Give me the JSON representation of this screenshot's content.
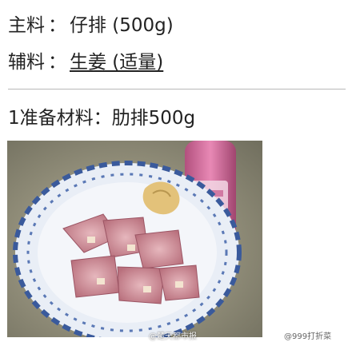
{
  "ingredients": {
    "main": {
      "label": "主料",
      "colon": "：",
      "value": "仔排 (500g)"
    },
    "aux": {
      "label": "辅料",
      "colon": "：",
      "value": "生姜 (适量)"
    }
  },
  "step": {
    "number": "1",
    "text": "准备材料：肋排500g"
  },
  "photo": {
    "description_icon": "photo-of-ribs-and-ginger-icon"
  },
  "watermarks": {
    "photo": "@楚天都市报",
    "site": "@999打折菜"
  },
  "colors": {
    "text": "#222222",
    "divider": "#b8b8b8",
    "plate_blue": "#3a5a9c",
    "meat": "#c98a92",
    "bottle": "#d06a9a"
  }
}
